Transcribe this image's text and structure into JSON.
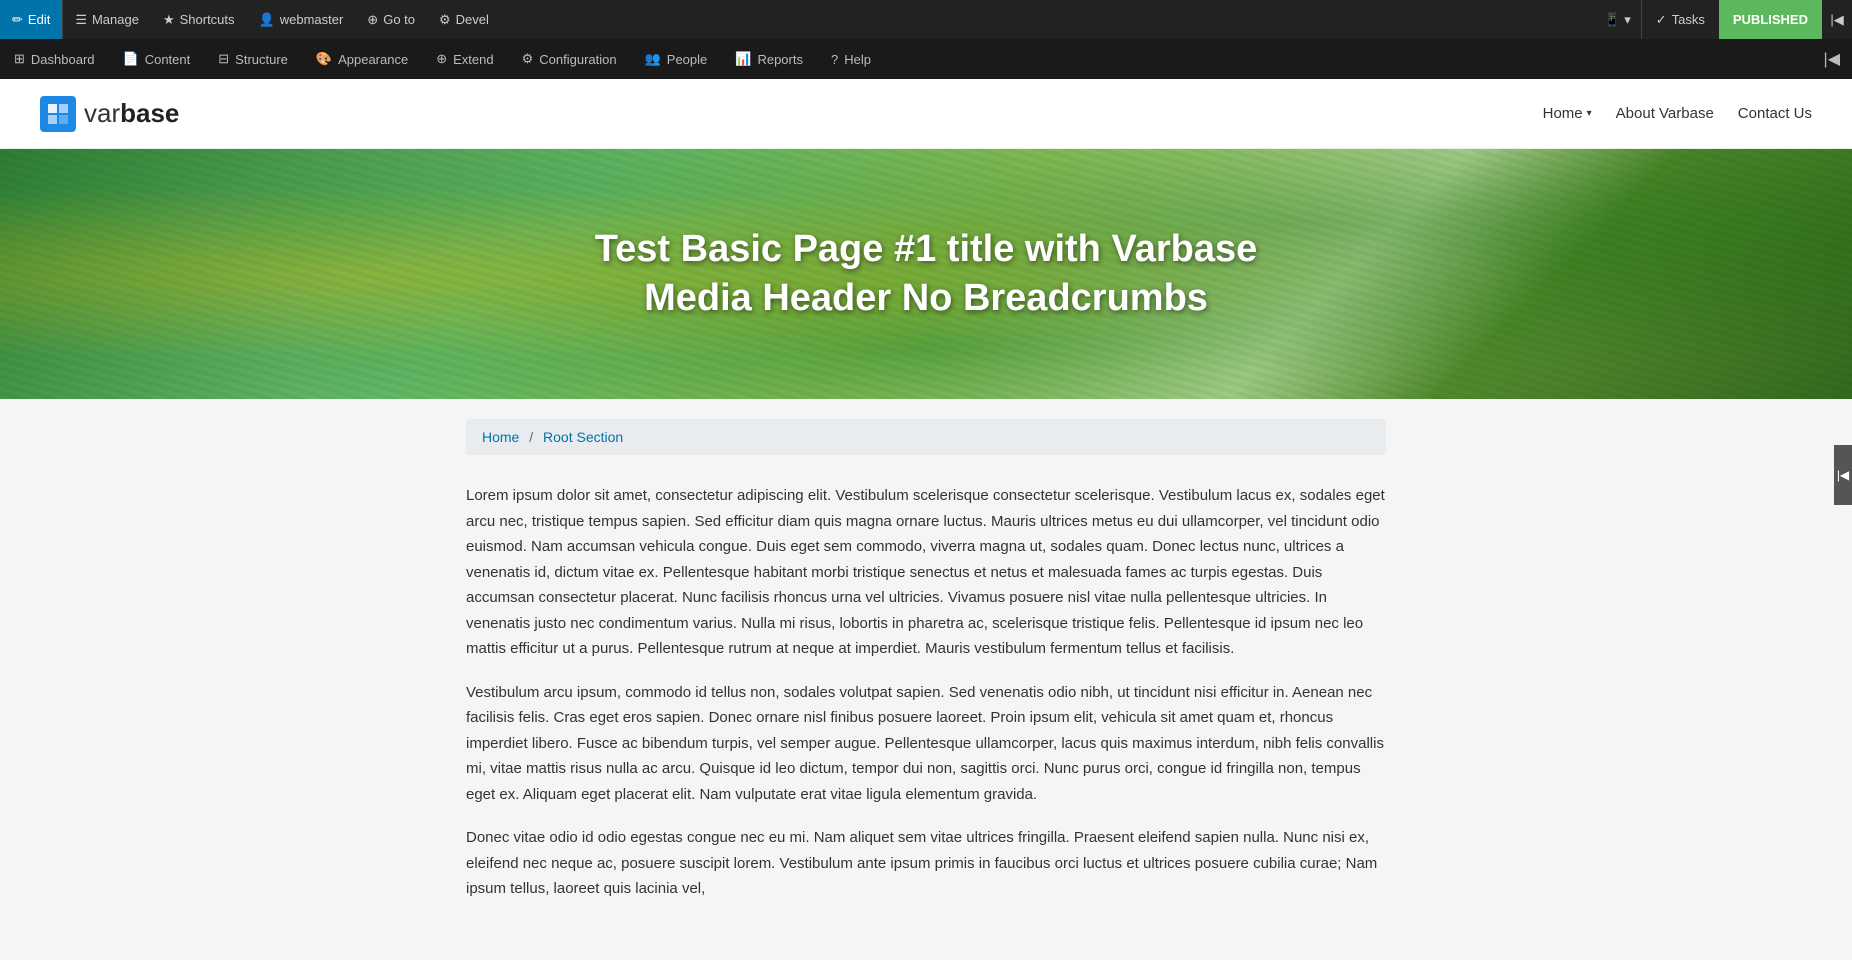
{
  "admin_toolbar": {
    "edit_label": "Edit",
    "manage_label": "Manage",
    "shortcuts_label": "Shortcuts",
    "user_label": "webmaster",
    "goto_label": "Go to",
    "devel_label": "Devel",
    "tasks_label": "Tasks",
    "published_label": "PUBLISHED"
  },
  "admin_menu": {
    "items": [
      {
        "id": "dashboard",
        "label": "Dashboard",
        "icon": "dashboard-icon"
      },
      {
        "id": "content",
        "label": "Content",
        "icon": "content-icon"
      },
      {
        "id": "structure",
        "label": "Structure",
        "icon": "structure-icon"
      },
      {
        "id": "appearance",
        "label": "Appearance",
        "icon": "appearance-icon"
      },
      {
        "id": "extend",
        "label": "Extend",
        "icon": "extend-icon"
      },
      {
        "id": "configuration",
        "label": "Configuration",
        "icon": "config-icon"
      },
      {
        "id": "people",
        "label": "People",
        "icon": "people-icon"
      },
      {
        "id": "reports",
        "label": "Reports",
        "icon": "reports-icon"
      },
      {
        "id": "help",
        "label": "Help",
        "icon": "help-icon"
      }
    ]
  },
  "site_header": {
    "logo_text_part1": "var",
    "logo_text_part2": "base",
    "nav": {
      "home": "Home",
      "about": "About Varbase",
      "contact": "Contact Us"
    }
  },
  "hero": {
    "title": "Test Basic Page #1 title with Varbase Media Header No Breadcrumbs"
  },
  "breadcrumb": {
    "home": "Home",
    "separator": "/",
    "current": "Root Section"
  },
  "body": {
    "paragraph1": "Lorem ipsum dolor sit amet, consectetur adipiscing elit. Vestibulum scelerisque consectetur scelerisque. Vestibulum lacus ex, sodales eget arcu nec, tristique tempus sapien. Sed efficitur diam quis magna ornare luctus. Mauris ultrices metus eu dui ullamcorper, vel tincidunt odio euismod. Nam accumsan vehicula congue. Duis eget sem commodo, viverra magna ut, sodales quam. Donec lectus nunc, ultrices a venenatis id, dictum vitae ex. Pellentesque habitant morbi tristique senectus et netus et malesuada fames ac turpis egestas. Duis accumsan consectetur placerat. Nunc facilisis rhoncus urna vel ultricies. Vivamus posuere nisl vitae nulla pellentesque ultricies. In venenatis justo nec condimentum varius. Nulla mi risus, lobortis in pharetra ac, scelerisque tristique felis. Pellentesque id ipsum nec leo mattis efficitur ut a purus. Pellentesque rutrum at neque at imperdiet. Mauris vestibulum fermentum tellus et facilisis.",
    "paragraph2": "Vestibulum arcu ipsum, commodo id tellus non, sodales volutpat sapien. Sed venenatis odio nibh, ut tincidunt nisi efficitur in. Aenean nec facilisis felis. Cras eget eros sapien. Donec ornare nisl finibus posuere laoreet. Proin ipsum elit, vehicula sit amet quam et, rhoncus imperdiet libero. Fusce ac bibendum turpis, vel semper augue. Pellentesque ullamcorper, lacus quis maximus interdum, nibh felis convallis mi, vitae mattis risus nulla ac arcu. Quisque id leo dictum, tempor dui non, sagittis orci. Nunc purus orci, congue id fringilla non, tempus eget ex. Aliquam eget placerat elit. Nam vulputate erat vitae ligula elementum gravida.",
    "paragraph3": "Donec vitae odio id odio egestas congue nec eu mi. Nam aliquet sem vitae ultrices fringilla. Praesent eleifend sapien nulla. Nunc nisi ex, eleifend nec neque ac, posuere suscipit lorem. Vestibulum ante ipsum primis in faucibus orci luctus et ultrices posuere cubilia curae; Nam ipsum tellus, laoreet quis lacinia vel,"
  }
}
